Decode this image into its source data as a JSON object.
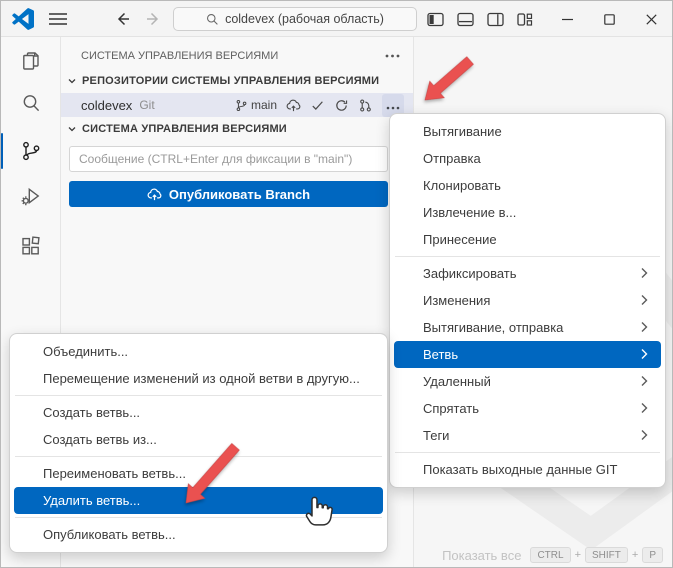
{
  "titlebar": {
    "search_value": "coldevex (рабочая область)",
    "icons": [
      "vscode-logo",
      "menu-icon",
      "back-icon",
      "forward-icon",
      "search-icon",
      "layout-sidebar-left-icon",
      "layout-panel-icon",
      "layout-sidebar-right-icon",
      "customize-layout-icon",
      "minimize-icon",
      "maximize-icon",
      "close-icon"
    ]
  },
  "activity_bar": {
    "items": [
      {
        "id": "explorer",
        "icon": "files-icon",
        "active": false
      },
      {
        "id": "search",
        "icon": "search-icon",
        "active": false
      },
      {
        "id": "source-control",
        "icon": "source-control-icon",
        "active": true
      },
      {
        "id": "run-debug",
        "icon": "debug-icon",
        "active": false
      },
      {
        "id": "extensions",
        "icon": "extensions-icon",
        "active": false
      }
    ]
  },
  "sidebar": {
    "panel_title": "СИСТЕМА УПРАВЛЕНИЯ ВЕРСИЯМИ",
    "repos_section_title": "РЕПОЗИТОРИИ СИСТЕМЫ УПРАВЛЕНИЯ ВЕРСИЯМИ",
    "scm_section_title": "СИСТЕМА УПРАВЛЕНИЯ ВЕРСИЯМИ",
    "repo": {
      "name": "coldevex",
      "provider": "Git",
      "branch": "main"
    },
    "commit_input_placeholder": "Сообщение (CTRL+Enter для фиксации в \"main\")",
    "publish_button_label": "Опубликовать Branch"
  },
  "context_menu": {
    "items": [
      {
        "id": "pull",
        "label": "Вытягивание"
      },
      {
        "id": "push",
        "label": "Отправка"
      },
      {
        "id": "clone",
        "label": "Клонировать"
      },
      {
        "id": "checkout-to",
        "label": "Извлечение в..."
      },
      {
        "id": "fetch",
        "label": "Принесение"
      },
      {
        "separator": true
      },
      {
        "id": "commit",
        "label": "Зафиксировать",
        "submenu": true
      },
      {
        "id": "changes",
        "label": "Изменения",
        "submenu": true
      },
      {
        "id": "pull-push",
        "label": "Вытягивание, отправка",
        "submenu": true
      },
      {
        "id": "branch",
        "label": "Ветвь",
        "submenu": true,
        "active": true
      },
      {
        "id": "remote",
        "label": "Удаленный",
        "submenu": true
      },
      {
        "id": "stash",
        "label": "Спрятать",
        "submenu": true
      },
      {
        "id": "tags",
        "label": "Теги",
        "submenu": true
      },
      {
        "separator": true
      },
      {
        "id": "show-git-output",
        "label": "Показать выходные данные GIT"
      }
    ]
  },
  "branch_submenu": {
    "items": [
      {
        "id": "merge",
        "label": "Объединить..."
      },
      {
        "id": "rebase",
        "label": "Перемещение изменений из одной ветви в другую..."
      },
      {
        "separator": true
      },
      {
        "id": "create-branch",
        "label": "Создать ветвь..."
      },
      {
        "id": "create-branch-from",
        "label": "Создать ветвь из..."
      },
      {
        "separator": true
      },
      {
        "id": "rename-branch",
        "label": "Переименовать ветвь..."
      },
      {
        "id": "delete-branch",
        "label": "Удалить ветвь...",
        "active": true
      },
      {
        "separator": true
      },
      {
        "id": "publish-branch",
        "label": "Опубликовать ветвь..."
      }
    ]
  },
  "editor": {
    "hint_label": "Показать все",
    "hint_keys": [
      "CTRL",
      "SHIFT",
      "P"
    ]
  },
  "colors": {
    "accent_blue": "#0067c0",
    "selection_row_bg": "#e4e6f1",
    "annotation_arrow_red": "#ea5150"
  }
}
